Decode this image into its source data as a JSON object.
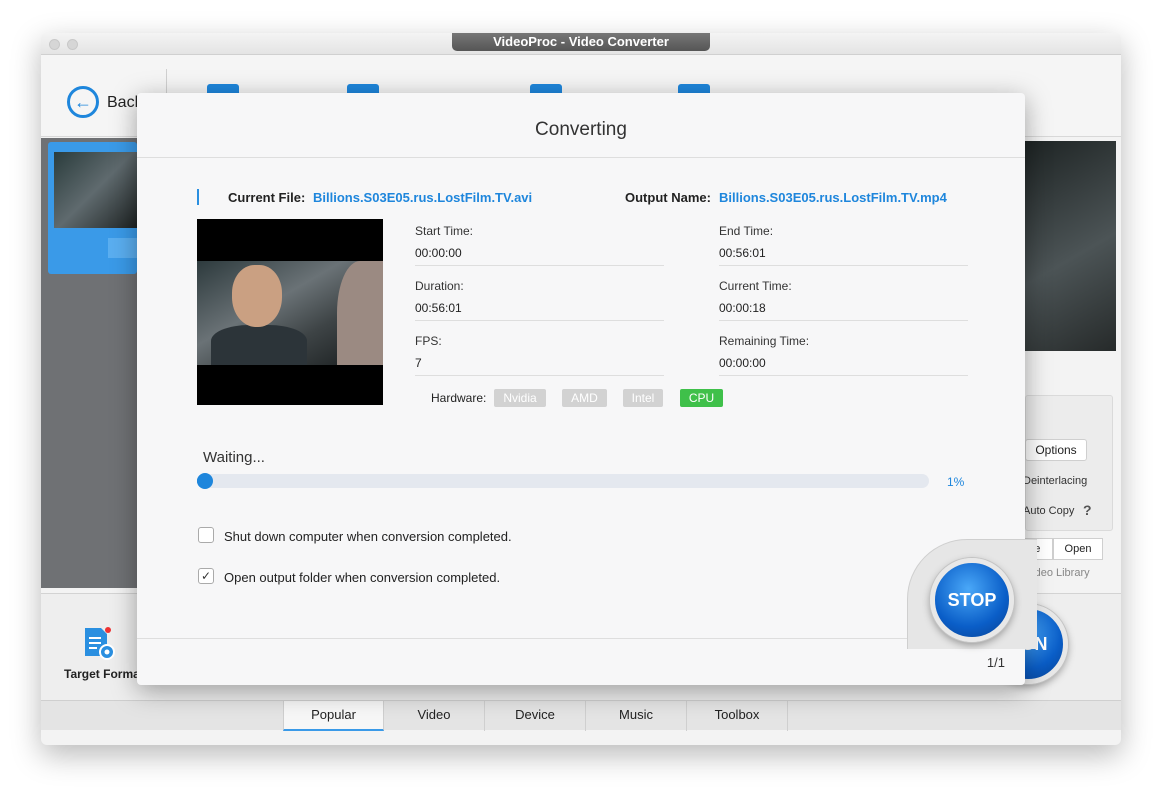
{
  "window": {
    "title": "VideoProc - Video Converter"
  },
  "toolbar": {
    "back_label": "Back"
  },
  "left_panel": {
    "target_format_label": "Target Format"
  },
  "right_panel": {
    "options_label": "Options",
    "deinterlacing_label": "Deinterlacing",
    "auto_copy_label": "Auto Copy",
    "help_label": "?",
    "browse_label": "Browse",
    "open_label": "Open",
    "video_library_label": "Video Library"
  },
  "tabs": [
    "Popular",
    "Video",
    "Device",
    "Music",
    "Toolbox"
  ],
  "run_label": "RUN",
  "dialog": {
    "title": "Converting",
    "current_file_label": "Current File:",
    "current_file": "Billions.S03E05.rus.LostFilm.TV.avi",
    "output_name_label": "Output Name:",
    "output_name": "Billions.S03E05.rus.LostFilm.TV.mp4",
    "start_time_label": "Start Time:",
    "start_time": "00:00:00",
    "end_time_label": "End Time:",
    "end_time": "00:56:01",
    "duration_label": "Duration:",
    "duration": "00:56:01",
    "current_time_label": "Current Time:",
    "current_time": "00:00:18",
    "fps_label": "FPS:",
    "fps": "7",
    "remaining_time_label": "Remaining Time:",
    "remaining_time": "00:00:00",
    "hardware_label": "Hardware:",
    "hardware": [
      {
        "name": "Nvidia",
        "active": false
      },
      {
        "name": "AMD",
        "active": false
      },
      {
        "name": "Intel",
        "active": false
      },
      {
        "name": "CPU",
        "active": true
      }
    ],
    "status": "Waiting...",
    "progress_percent": 1,
    "progress_label": "1%",
    "shutdown_label": "Shut down computer when conversion completed.",
    "shutdown_checked": false,
    "open_folder_label": "Open output folder when conversion completed.",
    "open_folder_checked": true,
    "stop_label": "STOP",
    "page_indicator": "1/1"
  },
  "colors": {
    "accent": "#1e86dc",
    "cpu_active": "#3fc04a",
    "inactive_badge": "#d2d2d2"
  }
}
